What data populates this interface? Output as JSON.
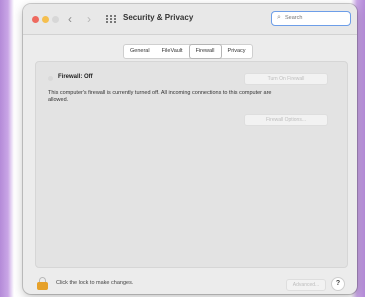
{
  "window": {
    "title": "Security & Privacy",
    "back_icon": "chevron-left-icon",
    "forward_icon": "chevron-right-icon",
    "grid_icon": "grid-icon"
  },
  "search": {
    "placeholder": "Search",
    "value": ""
  },
  "tabs": [
    {
      "label": "General",
      "active": false
    },
    {
      "label": "FileVault",
      "active": false
    },
    {
      "label": "Firewall",
      "active": true
    },
    {
      "label": "Privacy",
      "active": false
    }
  ],
  "firewall": {
    "status": "Firewall: Off",
    "turn_on_label": "Turn On Firewall",
    "description": "This computer's firewall is currently turned off. All incoming connections to this computer are allowed.",
    "options_label": "Firewall Options..."
  },
  "footer": {
    "lock_text": "Click the lock to make changes.",
    "advanced_label": "Advanced...",
    "help_label": "?"
  },
  "colors": {
    "close": "#ee6a5f",
    "minimize": "#f5bf4f",
    "search_border": "#6d9ee8",
    "lock": "#e6a12a"
  }
}
